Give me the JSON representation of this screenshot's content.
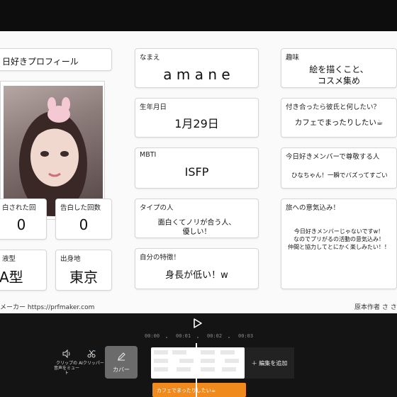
{
  "profile": {
    "header_title": "日好きプロフィール",
    "fields": {
      "name": {
        "label": "なまえ",
        "value": "a m a n e"
      },
      "hobby": {
        "label": "趣味",
        "value_line1": "絵を描くこと、",
        "value_line2": "コスメ集め"
      },
      "birthday": {
        "label": "生年月日",
        "value": "1月29日"
      },
      "relationship": {
        "label": "付き合ったら彼氏と何したい？",
        "value": "カフェでまったりしたい☕"
      },
      "mbti": {
        "label": "MBTI",
        "value": "ISFP"
      },
      "respected_member": {
        "label": "今日好きメンバーで尊敬する人",
        "value": "ひなちゃん！一瞬でバズってすごい"
      },
      "confessed_received": {
        "label": "白された回",
        "value": "0"
      },
      "confessed_made": {
        "label": "告白した回数",
        "value": "0"
      },
      "type": {
        "label": "タイプの人",
        "value_line1": "面白くてノリが合う人、",
        "value_line2": "優しい！"
      },
      "enthusiasm": {
        "label": "旅への意気込み！",
        "value_line1": "今日好きメンバーじゃないですw！",
        "value_line2": "なのでプリがるの活動の意気込み！",
        "value_line3": "仲間と協力してとにかく楽しみたい！！"
      },
      "blood_type": {
        "label": "液型",
        "value": "A型"
      },
      "hometown": {
        "label": "出身地",
        "value": "東京"
      },
      "feature": {
        "label": "自分の特徴！",
        "value": "身長が低い！w"
      }
    },
    "footer_left": "メーカー https://prfmaker.com",
    "footer_right": "原本作者 さ さ"
  },
  "editor": {
    "time_ticks": [
      "00:00",
      "00:01",
      "00:02",
      "00:03"
    ],
    "tools": {
      "mute_line1": "クリップの",
      "mute_line2": "音声をミュー",
      "mute_line3": "ト",
      "ai_cutter": "AIクリッパー",
      "cover": "カバー"
    },
    "add_edit": "＋ 編集を追加",
    "text_clip": "カフェでまったりしたい☕"
  },
  "icons": {
    "play": "play-icon",
    "volume": "volume-icon",
    "scissors": "scissors-icon",
    "pencil": "pencil-icon"
  },
  "colors": {
    "text_track": "#f08a1c",
    "editor_bg": "#141414"
  }
}
